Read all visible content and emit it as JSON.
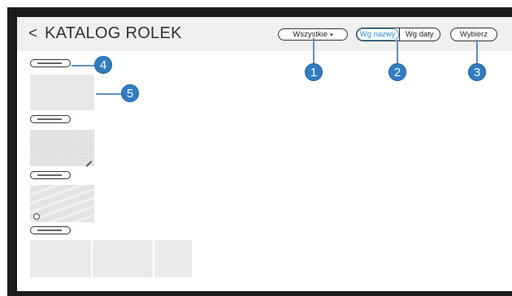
{
  "header": {
    "back_glyph": "<",
    "title": "KATALOG ROLEK"
  },
  "filter": {
    "label": "Wszystkie",
    "caret": "▾"
  },
  "sort": {
    "by_name": "Wg nazwy",
    "by_date": "Wg daty",
    "selected": "by_name"
  },
  "select_button": "Wybierz",
  "callouts": [
    "1",
    "2",
    "3",
    "4",
    "5"
  ],
  "accent_color": "#2f7dc7",
  "icons": {
    "back": "chevron-left-icon",
    "caret": "caret-down-icon"
  }
}
